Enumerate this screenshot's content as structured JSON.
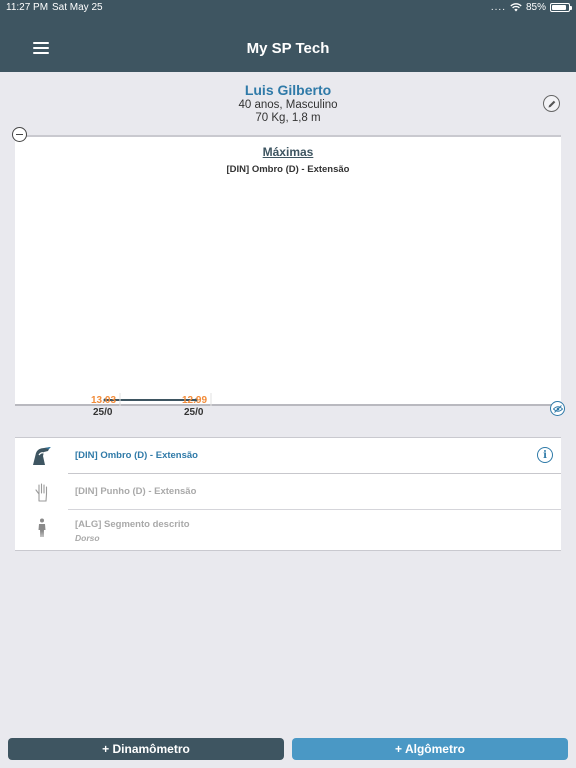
{
  "status_bar": {
    "time": "11:27 PM",
    "date": "Sat May 25",
    "signal_dots": "....",
    "battery_percent": "85%",
    "battery_level": 0.85,
    "icons": [
      "wifi-icon",
      "battery-icon"
    ]
  },
  "navbar": {
    "title": "My SP Tech",
    "menu_icon": "hamburger-menu-icon"
  },
  "profile": {
    "name": "Luis Gilberto",
    "age_sex": "40 anos, Masculino",
    "body": "70 Kg, 1,8 m",
    "edit_icon": "pencil-icon"
  },
  "chart_data": {
    "type": "line",
    "title": "Máximas",
    "subtitle": "[DIN] Ombro (D) - Extensão",
    "x": [
      "25/05",
      "25/05"
    ],
    "x_labels_display": [
      "25/0",
      "25/0"
    ],
    "series": [
      {
        "values": [
          13.03,
          12.99
        ]
      }
    ],
    "value_labels": [
      "13.03",
      "12.99"
    ],
    "grid": false,
    "colors": {
      "line": "#3e5561",
      "labels": "#f28c3a"
    }
  },
  "device_list": {
    "items": [
      {
        "label": "[DIN] Ombro (D) - Extensão",
        "icon": "shoulder-icon",
        "selected": true,
        "info_icon": "info-icon"
      },
      {
        "label": "[DIN] Punho (D) - Extensão",
        "icon": "hand-icon",
        "selected": false
      },
      {
        "label": "[ALG] Segmento descrito",
        "sublabel": "Dorso",
        "icon": "body-icon",
        "selected": false
      }
    ]
  },
  "buttons": {
    "dinamometro": "+ Dinamômetro",
    "algometro": "+ Algômetro"
  },
  "colors": {
    "header": "#3e5561",
    "accent": "#2f7aa8",
    "button_secondary": "#4a98c5",
    "value_label": "#f28c3a"
  }
}
